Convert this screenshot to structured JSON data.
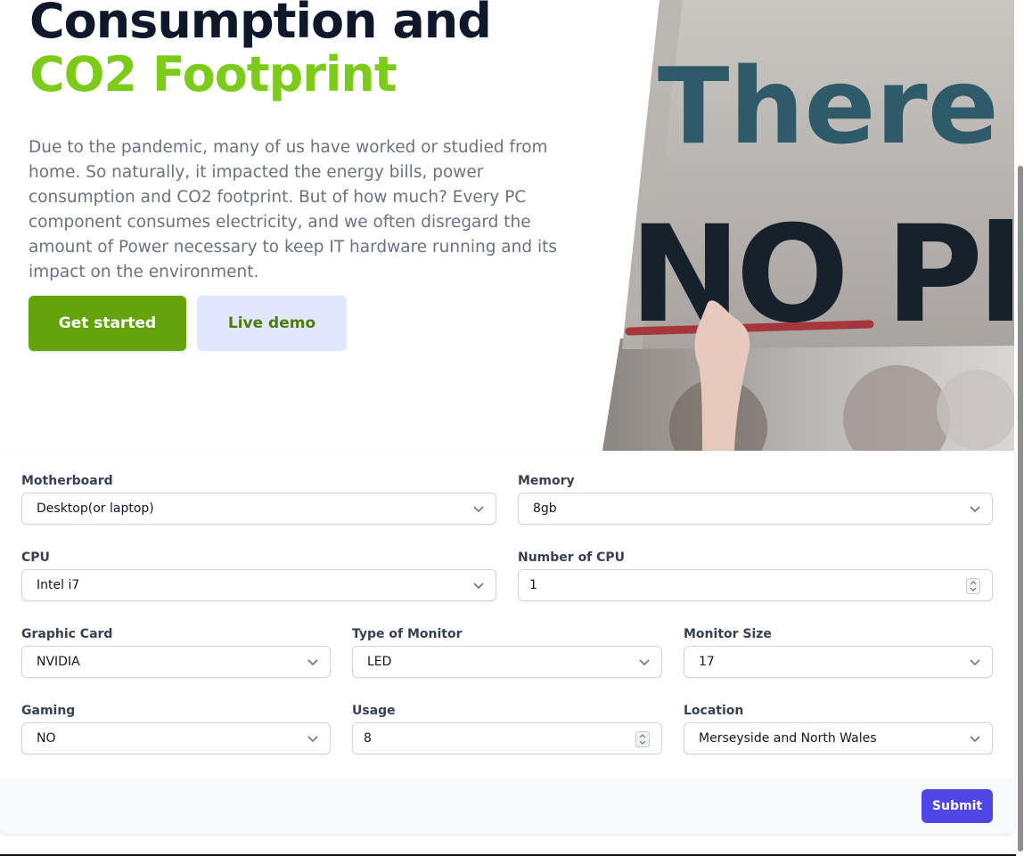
{
  "hero": {
    "title_line1": "Consumption and",
    "title_line2": "CO2 Footprint",
    "description": "Due to the pandemic, many of us have worked or studied from home. So naturally, it impacted the energy bills, power consumption and CO2 footprint. But of how much? Every PC component consumes electricity, and we often disregard the amount of Power necessary to keep IT hardware running and its impact on the environment.",
    "primary_button": "Get started",
    "secondary_button": "Live demo",
    "image_text_line1": "There is",
    "image_text_line2": "NO PlanetB",
    "colors": {
      "title_dark": "#0f172a",
      "title_accent": "#7ccb18",
      "primary": "#65a30d",
      "secondary_bg": "#e0e7ff"
    }
  },
  "form": {
    "motherboard": {
      "label": "Motherboard",
      "value": "Desktop(or laptop)"
    },
    "memory": {
      "label": "Memory",
      "value": "8gb"
    },
    "cpu": {
      "label": "CPU",
      "value": "Intel i7"
    },
    "number_of_cpu": {
      "label": "Number of CPU",
      "value": "1"
    },
    "graphic_card": {
      "label": "Graphic Card",
      "value": "NVIDIA"
    },
    "type_of_monitor": {
      "label": "Type of Monitor",
      "value": "LED"
    },
    "monitor_size": {
      "label": "Monitor Size",
      "value": "17"
    },
    "gaming": {
      "label": "Gaming",
      "value": "NO"
    },
    "usage": {
      "label": "Usage",
      "value": "8"
    },
    "location": {
      "label": "Location",
      "value": "Merseyside and North Wales"
    },
    "submit_label": "Submit",
    "colors": {
      "submit": "#4f46e5"
    }
  }
}
